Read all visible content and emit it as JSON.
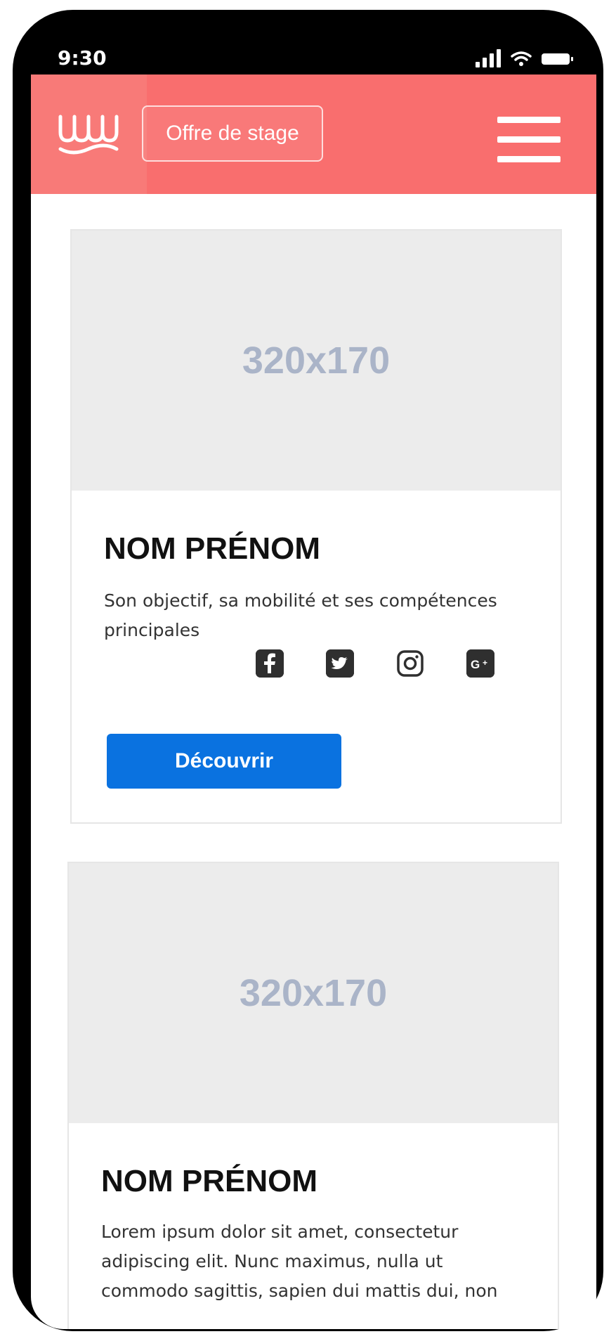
{
  "status_bar": {
    "time": "9:30",
    "icons": [
      "signal-icon",
      "wifi-icon",
      "battery-icon"
    ]
  },
  "header": {
    "logo_icon": "wave-logo-icon",
    "offer_label": "Offre de stage",
    "menu_icon": "hamburger-menu-icon",
    "background_color": "#f96e6e"
  },
  "cards": [
    {
      "image_placeholder": "320x170",
      "name": "NOM PRÉNOM",
      "description": "Son objectif, sa mobilité et ses compétences principales",
      "social_icons": [
        "facebook-icon",
        "twitter-icon",
        "instagram-icon",
        "google-plus-icon"
      ],
      "button_label": "Découvrir"
    },
    {
      "image_placeholder": "320x170",
      "name": "NOM PRÉNOM",
      "description": "Lorem ipsum dolor sit amet, consectetur adipiscing elit. Nunc maximus, nulla ut commodo sagittis, sapien dui mattis dui, non"
    }
  ],
  "colors": {
    "accent": "#f96e6e",
    "button": "#0a72e0",
    "placeholder_text": "#aab4c8"
  }
}
